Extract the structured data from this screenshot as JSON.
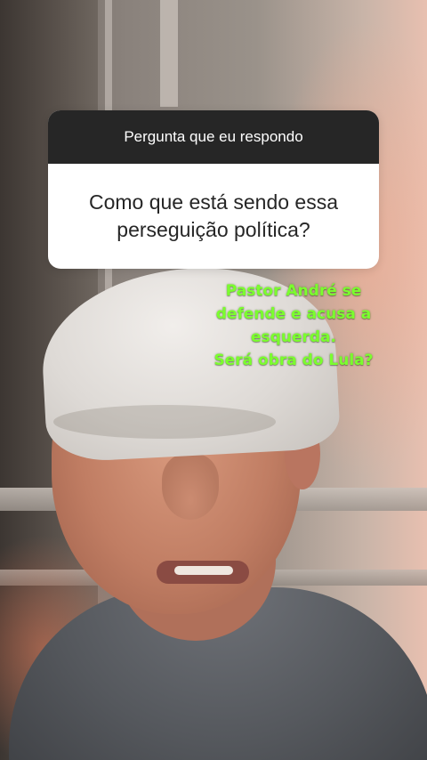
{
  "question_sticker": {
    "header": "Pergunta que eu respondo",
    "question_line1": "Como que está sendo essa",
    "question_line2": "perseguição política?"
  },
  "caption": {
    "line1": "Pastor André se",
    "line2": "defende e acusa a",
    "line3": "esquerda.",
    "line4": "Será obra do Lula?",
    "color": "#7bff2e"
  },
  "colors": {
    "sticker_header_bg": "#262626",
    "sticker_body_bg": "#ffffff"
  }
}
